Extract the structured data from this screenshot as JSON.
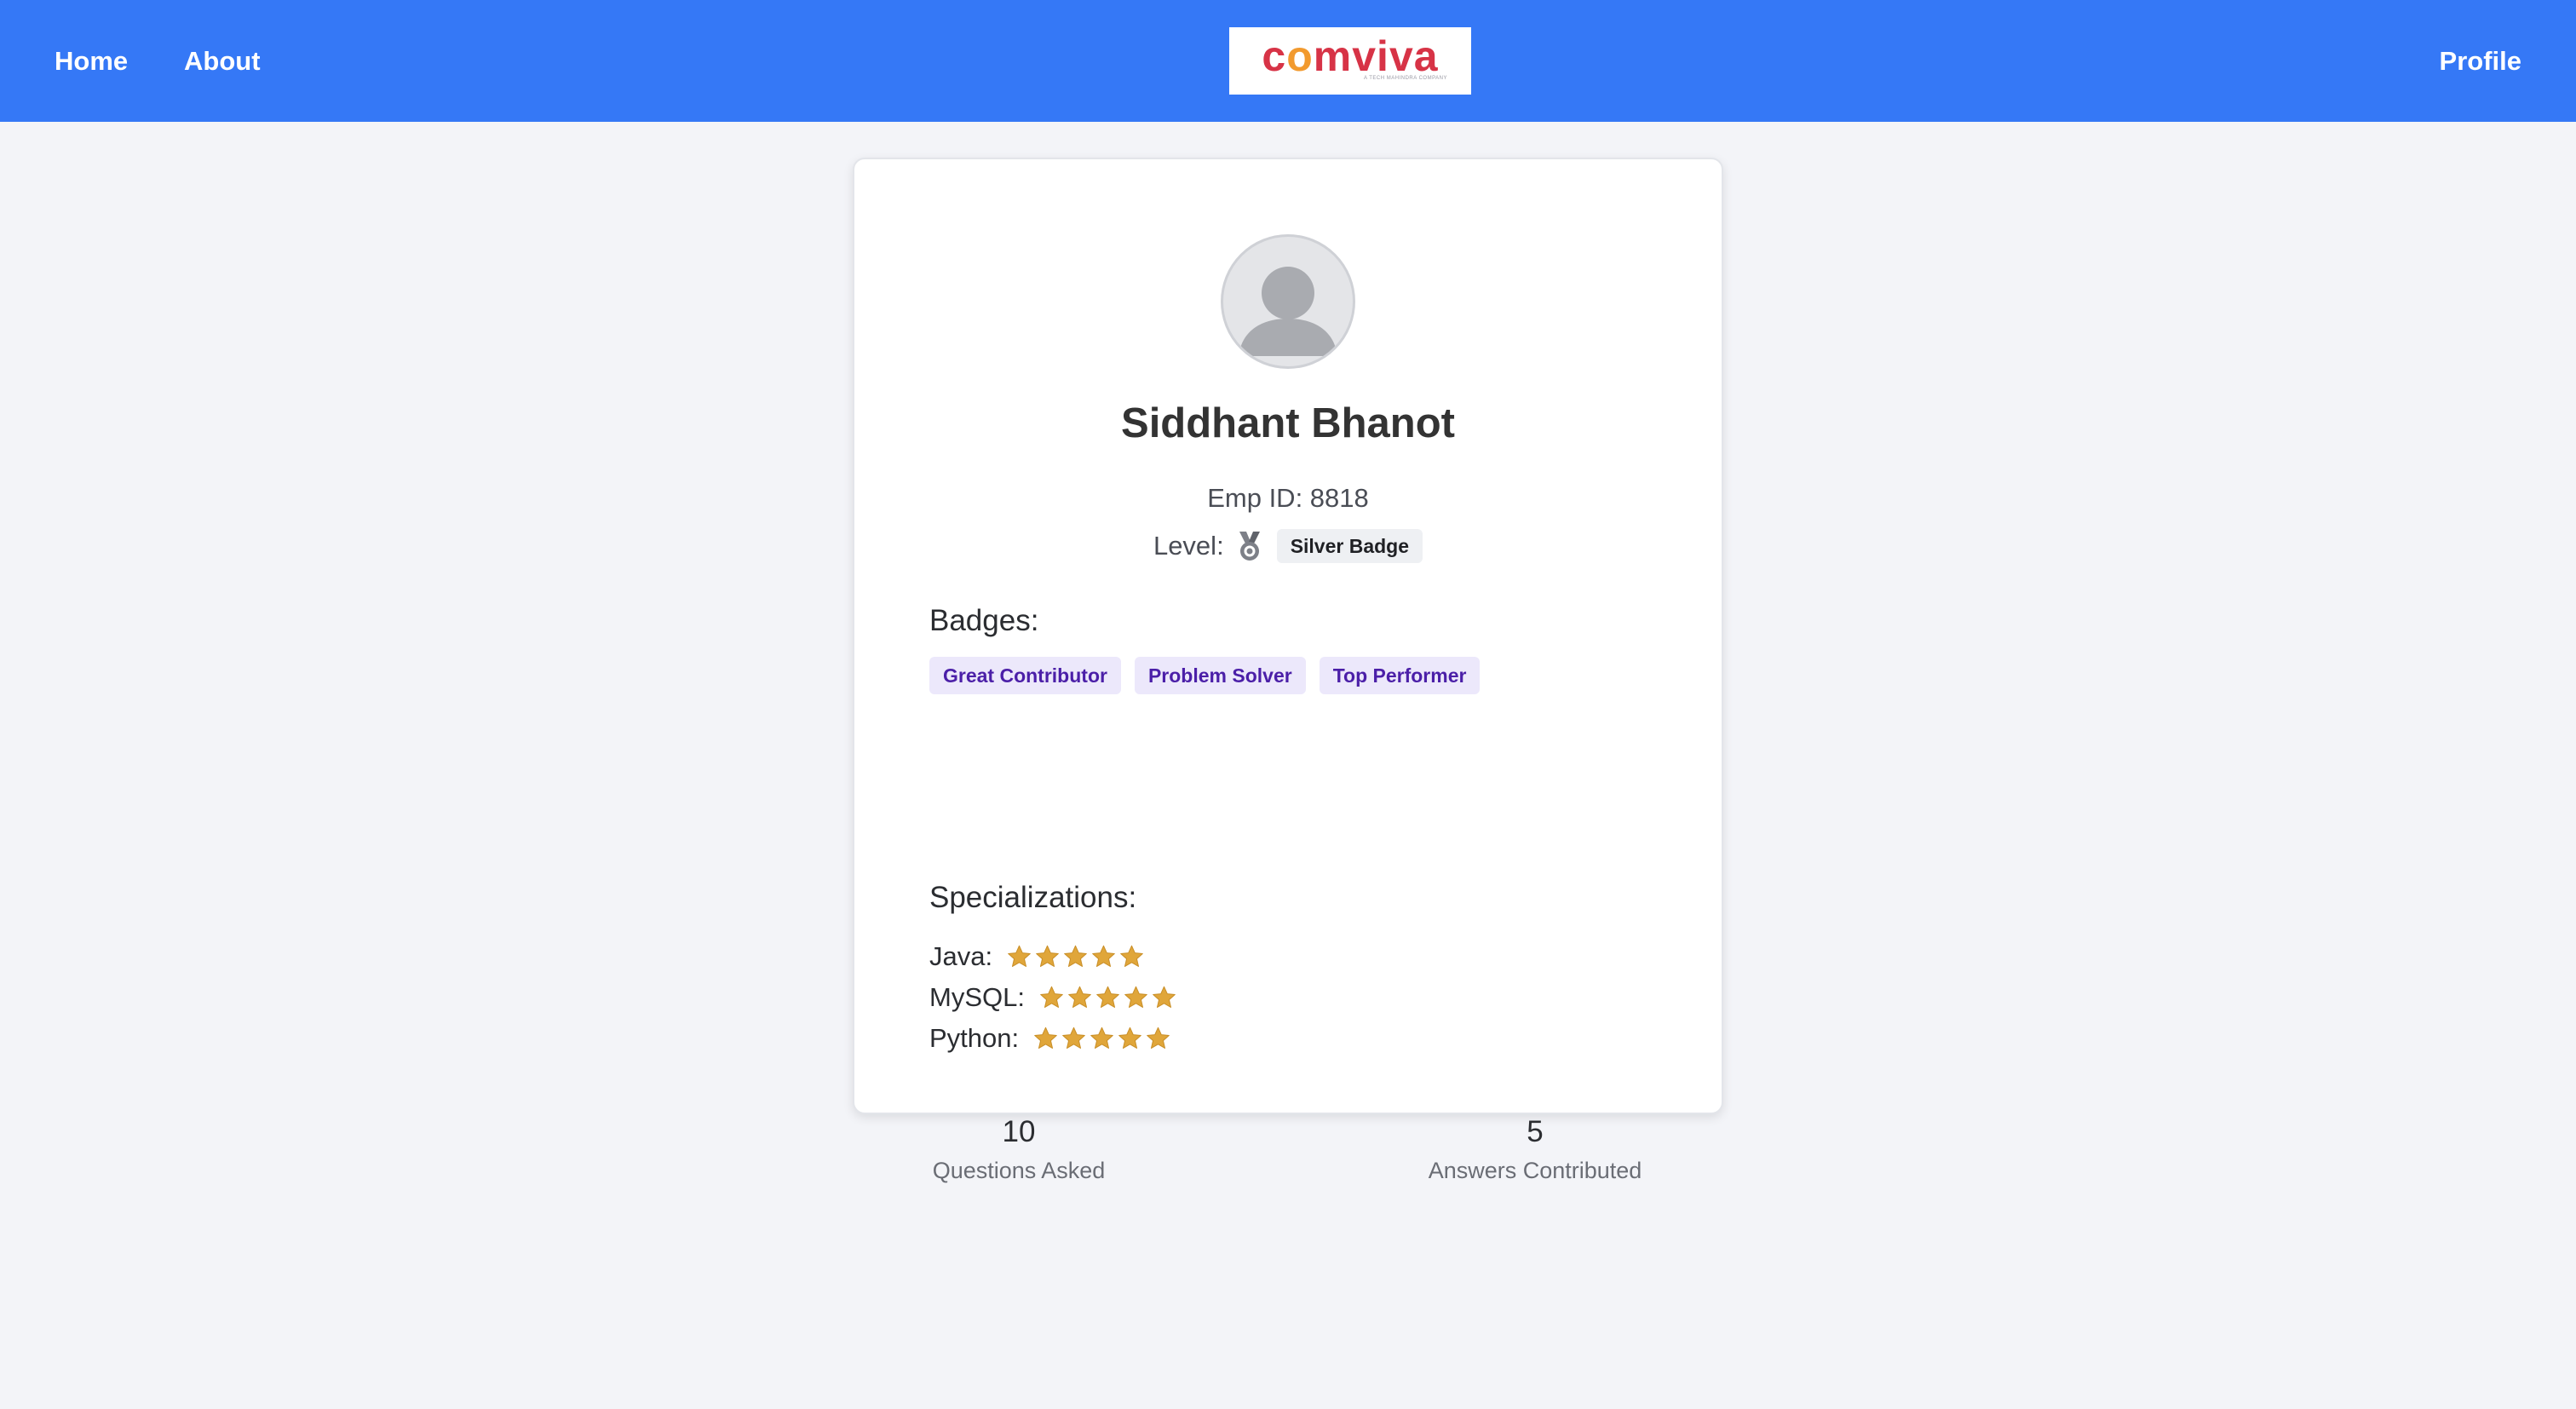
{
  "nav": {
    "home_label": "Home",
    "about_label": "About",
    "profile_label": "Profile",
    "logo_text": "comviva",
    "logo_tagline": "A TECH MAHINDRA COMPANY"
  },
  "profile": {
    "name": "Siddhant Bhanot",
    "emp_id": "Emp ID: 8818",
    "level_label": "Level:",
    "level_icon": "medal-icon",
    "level_value": "Silver Badge",
    "badges_heading": "Badges:",
    "badges": [
      "Great Contributor",
      "Problem Solver",
      "Top Performer"
    ],
    "specializations_heading": "Specializations:",
    "specializations": [
      {
        "label": "Java:",
        "rating": 5,
        "max": 5
      },
      {
        "label": "MySQL:",
        "rating": 5,
        "max": 5
      },
      {
        "label": "Python:",
        "rating": 5,
        "max": 5
      }
    ],
    "stats": {
      "questions_value": "10",
      "questions_label": "Questions Asked",
      "answers_value": "5",
      "answers_label": "Answers Contributed"
    }
  },
  "colors": {
    "nav_background": "#3578f6",
    "page_background": "#f3f4f8",
    "logo_red": "#d73346",
    "logo_orange": "#f29a2e",
    "badge_chip_bg": "#ece8fb",
    "badge_chip_text": "#4b1fa8",
    "star": "#e0a63a"
  }
}
